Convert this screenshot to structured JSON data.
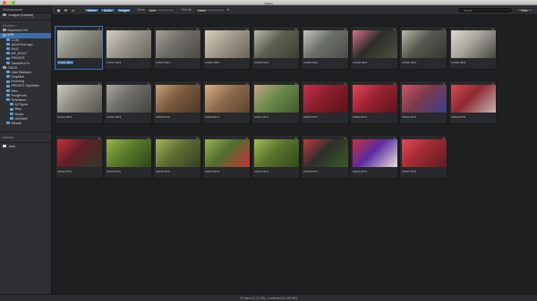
{
  "window": {
    "title": "Kyno"
  },
  "sidebar": {
    "workspaces_label": "Workspaces",
    "workspace_current": "Analyze (Default)",
    "devices_label": "Devices",
    "rows": [
      {
        "label": "Macintosh HD",
        "icon": "drive-icon",
        "depth": 0,
        "selected": false
      },
      {
        "label": "K75",
        "icon": "drive-icon",
        "depth": 0,
        "selected": true
      },
      {
        "label": "C136",
        "icon": "folder-icon",
        "depth": 1,
        "selected": false
      },
      {
        "label": "QuickTime.app",
        "icon": "folder-icon",
        "depth": 1,
        "selected": false
      },
      {
        "label": "MXG",
        "icon": "folder-icon",
        "depth": 1,
        "selected": false
      },
      {
        "label": "MP_ROOT",
        "icon": "folder-icon",
        "depth": 1,
        "selected": false
      },
      {
        "label": "PRIVATE",
        "icon": "folder-icon",
        "depth": 1,
        "selected": false
      },
      {
        "label": "Samples.k7s",
        "icon": "folder-icon",
        "depth": 1,
        "selected": false
      },
      {
        "label": "CMOS",
        "icon": "drive-icon",
        "depth": 0,
        "selected": false
      },
      {
        "label": "Card Backups",
        "icon": "folder-icon",
        "depth": 1,
        "selected": false
      },
      {
        "label": "Graphics",
        "icon": "folder-icon",
        "depth": 1,
        "selected": false
      },
      {
        "label": "Incoming",
        "icon": "folder-icon",
        "depth": 1,
        "selected": false
      },
      {
        "label": "PRIVATE Stylebible",
        "icon": "folder-icon",
        "depth": 1,
        "selected": false
      },
      {
        "label": "Misc",
        "icon": "folder-icon",
        "depth": 1,
        "selected": false
      },
      {
        "label": "Roughcuts",
        "icon": "folder-icon",
        "depth": 1,
        "selected": false
      },
      {
        "label": "Selections",
        "icon": "folder-icon",
        "depth": 1,
        "selected": false
      },
      {
        "label": "All Types",
        "icon": "folder-icon",
        "depth": 2,
        "selected": false
      },
      {
        "label": "Misc",
        "icon": "folder-icon",
        "depth": 2,
        "selected": false
      },
      {
        "label": "Stoics",
        "icon": "folder-icon",
        "depth": 2,
        "selected": false
      },
      {
        "label": "Unlinked",
        "icon": "folder-icon",
        "depth": 2,
        "selected": false
      },
      {
        "label": "Steady",
        "icon": "folder-icon",
        "depth": 1,
        "selected": false
      }
    ],
    "activity_label": "Activity",
    "jobs_label": "Jobs"
  },
  "toolbar": {
    "view_buttons": [
      "▦",
      "☰",
      "▭"
    ],
    "filter_buttons": [
      "Videos",
      "Audio",
      "Images"
    ],
    "zoom_label": "Zoom",
    "zoom_value": "Auto",
    "sort_label": "Sort by",
    "sort_value": "Name",
    "search_placeholder": "Search",
    "filter_label": "Filter"
  },
  "tiles": [
    {
      "caption": "C0011.MP4",
      "colors": [
        "#8a8a82",
        "#c7c4b8",
        "#5d5a52"
      ],
      "selected": true
    },
    {
      "caption": "C0012.MP4",
      "colors": [
        "#9a978c",
        "#d2d0c5",
        "#68655c"
      ],
      "selected": false
    },
    {
      "caption": "C0013.MP4",
      "colors": [
        "#6e6c66",
        "#a6a398",
        "#4b4944"
      ],
      "selected": false
    },
    {
      "caption": "C0022.MP4",
      "colors": [
        "#a19a8c",
        "#d7d0c0",
        "#6b6458"
      ],
      "selected": false
    },
    {
      "caption": "C0023.MP4",
      "colors": [
        "#5d5f4e",
        "#b9b9a8",
        "#3c3d33"
      ],
      "selected": false
    },
    {
      "caption": "C0020.MP4",
      "colors": [
        "#6b6f6a",
        "#c2c5c0",
        "#4a4d49"
      ],
      "selected": false
    },
    {
      "caption": "C0018.MP4",
      "colors": [
        "#2b2d27",
        "#d9718b",
        "#4d5244"
      ],
      "selected": false
    },
    {
      "caption": "C0016.MP4",
      "colors": [
        "#55584f",
        "#b8b8ad",
        "#34362f"
      ],
      "selected": false
    },
    {
      "caption": "C0015.MP4",
      "colors": [
        "#a7a49a",
        "#dcdad2",
        "#464640"
      ],
      "selected": false
    },
    {
      "caption": "C0013.MP4",
      "colors": [
        "#8d8b82",
        "#cecbc1",
        "#55534c"
      ],
      "selected": false
    },
    {
      "caption": "C0014.MP4",
      "colors": [
        "#6c6b66",
        "#a9a7a0",
        "#44433f"
      ],
      "selected": false
    },
    {
      "caption": "00256.MTS",
      "colors": [
        "#7a5b3e",
        "#c8a17a",
        "#4e3826"
      ],
      "selected": false
    },
    {
      "caption": "00258.MTS",
      "colors": [
        "#8d6c4c",
        "#d9b48a",
        "#5c4330"
      ],
      "selected": false
    },
    {
      "caption": "00257.MTS",
      "colors": [
        "#6a8a4a",
        "#c9a78c",
        "#3e5a2c"
      ],
      "selected": false
    },
    {
      "caption": "00255.MTS",
      "colors": [
        "#8a1f2c",
        "#c4314a",
        "#5a121c"
      ],
      "selected": false
    },
    {
      "caption": "00253.MTS",
      "colors": [
        "#9b2231",
        "#e4495c",
        "#5b1520"
      ],
      "selected": false
    },
    {
      "caption": "00251.MTS",
      "colors": [
        "#7a3a4a",
        "#d15566",
        "#3a3f8c"
      ],
      "selected": false
    },
    {
      "caption": "00250.MTS",
      "colors": [
        "#8c2a33",
        "#d4494f",
        "#c9b7b5"
      ],
      "selected": false
    },
    {
      "caption": "00232.MTS",
      "colors": [
        "#5c1f24",
        "#c2323b",
        "#2f3a2a"
      ],
      "selected": false
    },
    {
      "caption": "00236.MTS",
      "colors": [
        "#5a7a2a",
        "#9ab44e",
        "#2f4418"
      ],
      "selected": false
    },
    {
      "caption": "00235.MTS",
      "colors": [
        "#5e6e33",
        "#a7b65a",
        "#344020"
      ],
      "selected": false
    },
    {
      "caption": "00234.MTS",
      "colors": [
        "#4f6e2d",
        "#9cb255",
        "#c5313b"
      ],
      "selected": false
    },
    {
      "caption": "00233.MTS",
      "colors": [
        "#5a742c",
        "#a5bd56",
        "#324818"
      ],
      "selected": false
    },
    {
      "caption": "00230.MTS",
      "colors": [
        "#2e2f2a",
        "#c43b3d",
        "#3c5a2a"
      ],
      "selected": false
    },
    {
      "caption": "00244.MTS",
      "colors": [
        "#5b2ca0",
        "#c7303c",
        "#e9dfdc"
      ],
      "selected": false
    },
    {
      "caption": "00287.MTS",
      "colors": [
        "#a12a33",
        "#e34a54",
        "#5f1c20"
      ],
      "selected": false
    }
  ],
  "status": {
    "text": "26 items (2.12 GB), 1 selected (21.55 MB)"
  }
}
